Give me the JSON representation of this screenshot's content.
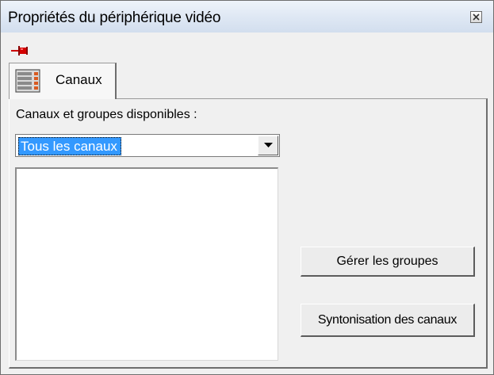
{
  "window": {
    "title": "Propriétés du périphérique vidéo"
  },
  "titlebar": {
    "close_icon": "close-icon",
    "pin_icon": "pushpin-icon"
  },
  "tabs": [
    {
      "label": "Canaux",
      "icon": "channel-list-icon",
      "selected": true
    }
  ],
  "channels": {
    "label": "Canaux et groupes disponibles :",
    "selected_value": "Tous les canaux",
    "list_items": []
  },
  "buttons": {
    "manage_groups": "Gérer les groupes",
    "tuning": "Syntonisation des canaux"
  },
  "colors": {
    "selection": "#3399ff",
    "pin_red": "#cc0000"
  }
}
